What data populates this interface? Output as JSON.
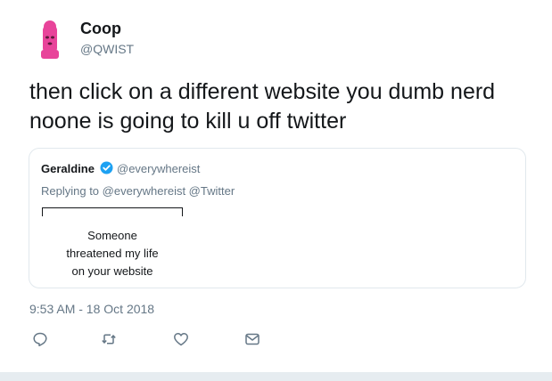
{
  "tweet": {
    "author_name": "Coop",
    "author_handle": "@QWIST",
    "text": "then click on a different website you dumb nerd noone is going to kill u off twitter",
    "timestamp": "9:53 AM - 18 Oct 2018"
  },
  "quoted_tweet": {
    "author_name": "Geraldine",
    "author_handle": "@everywhereist",
    "verified": true,
    "replying_prefix": "Replying to",
    "replying_to": "@everywhereist @Twitter",
    "sign_lines": [
      "Someone",
      "threatened my life",
      "on your website"
    ]
  },
  "actions": [
    {
      "icon": "reply-icon"
    },
    {
      "icon": "retweet-icon"
    },
    {
      "icon": "like-icon"
    },
    {
      "icon": "direct-message-icon"
    }
  ],
  "colors": {
    "text": "#14171a",
    "secondary": "#657786",
    "verified": "#1da1f2",
    "avatar": "#e8449a",
    "border": "#e1e8ed"
  }
}
